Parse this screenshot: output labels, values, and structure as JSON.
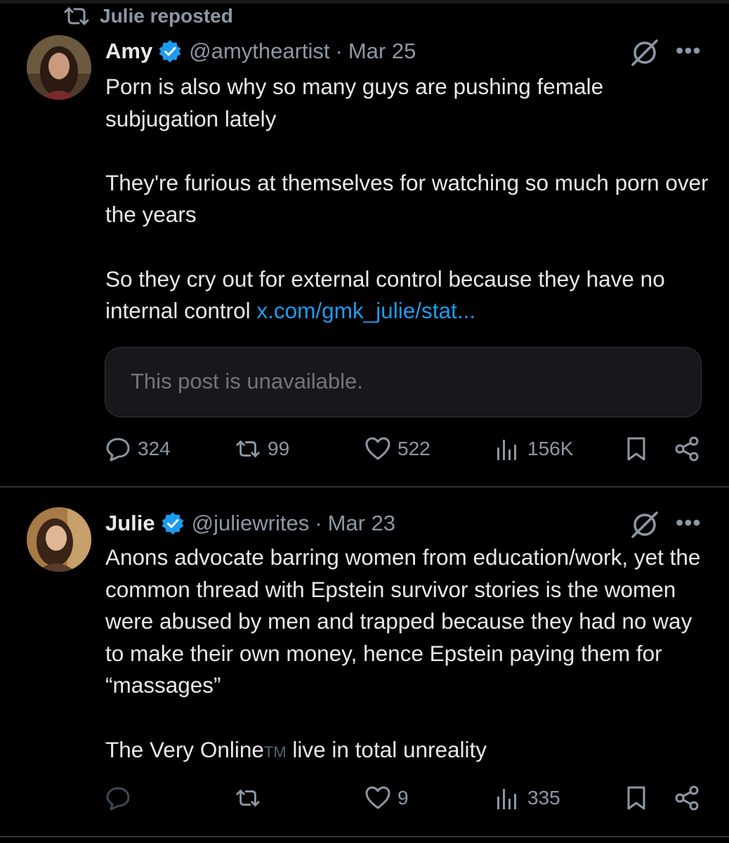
{
  "repost_label": "Julie reposted",
  "tweets": [
    {
      "name": "Amy",
      "handle": "@amytheartist",
      "separator": "·",
      "date": "Mar 25",
      "paragraphs": [
        "Porn is also why so many guys are pushing female subjugation lately",
        "They're furious at themselves for watching so much porn over the years",
        "So they cry out for external control because they have no internal control"
      ],
      "link": "x.com/gmk_julie/stat...",
      "quote_text": "This post is unavailable.",
      "stats": {
        "replies": "324",
        "reposts": "99",
        "likes": "522",
        "views": "156K"
      }
    },
    {
      "name": "Julie",
      "handle": "@juliewrites",
      "separator": "·",
      "date": "Mar 23",
      "paragraphs": [
        "Anons advocate barring women from education/work, yet the common thread with Epstein survivor stories is the women were abused by men and trapped because they had no way to make their own money, hence Epstein paying them for “massages”"
      ],
      "last_line_before": "The Very Online",
      "trademark": "TM",
      "last_line_after": " live in total unreality",
      "stats": {
        "replies": "",
        "reposts": "",
        "likes": "9",
        "views": "335"
      }
    }
  ],
  "colors": {
    "background": "#000000",
    "text": "#e7e9ea",
    "secondary": "#8b98a5",
    "link": "#1d9bf0",
    "verified": "#1d9bf0"
  },
  "icons": [
    "repost-icon",
    "verified-badge-icon",
    "grok-icon",
    "more-icon",
    "reply-icon",
    "like-icon",
    "views-icon",
    "bookmark-icon",
    "share-icon"
  ]
}
